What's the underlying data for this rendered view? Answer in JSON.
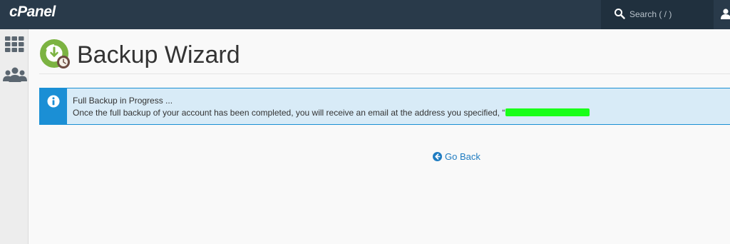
{
  "topbar": {
    "logo_text": "cPanel",
    "search": {
      "placeholder": "Search ( / )"
    }
  },
  "icons": {
    "search": "search-icon",
    "user": "user-icon",
    "grid": "grid-icon",
    "users": "users-icon",
    "page": "backup-wizard-icon",
    "info": "info-icon",
    "back": "arrow-left-circle-icon"
  },
  "page": {
    "title": "Backup Wizard"
  },
  "alert": {
    "title": "Full Backup in Progress ...",
    "message": "Once the full backup of your account has been completed, you will receive an email at the address you specified, “"
  },
  "go_back": {
    "label": "Go Back"
  },
  "colors": {
    "topbar": "#293a4a",
    "alert_accent": "#1b8fd5",
    "alert_bg": "#d8ebf7",
    "link": "#1f7cc1",
    "redaction": "#19ff19"
  }
}
